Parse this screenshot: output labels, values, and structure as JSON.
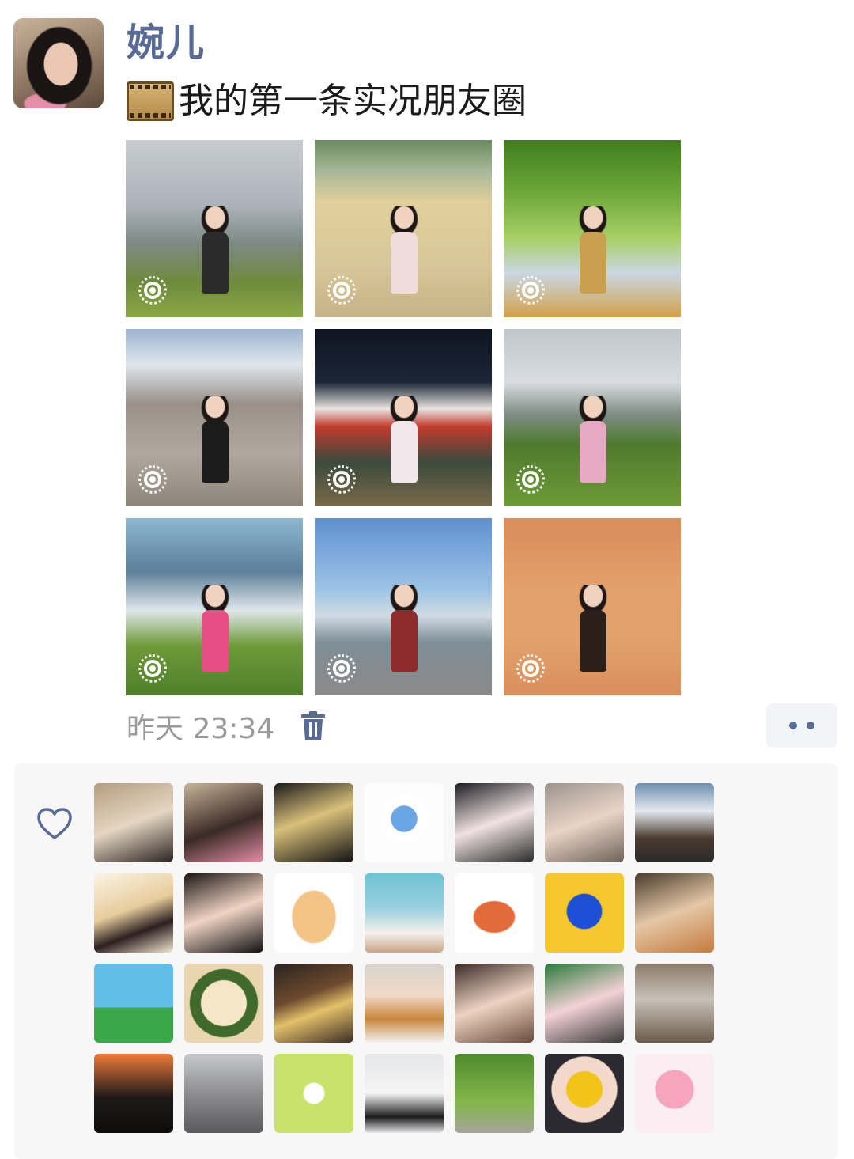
{
  "post": {
    "author": "婉儿",
    "text": "我的第一条实况朋友圈",
    "time": "昨天 23:34"
  },
  "photos": [
    {
      "name": "photo-mountain-rocks",
      "bg": "linear-gradient(180deg,#c8ccd1 0%,#aab1b8 38%,#7f8a86 58%,#6e8a3c 80%,#8aa845 100%)",
      "cloth": "#2b2b2b"
    },
    {
      "name": "photo-travertine-terraces",
      "bg": "linear-gradient(180deg,#6a8c5e 0%,#a9b89a 18%,#e1cf9c 35%,#d8c79a 70%,#c6b387 100%)",
      "cloth": "#f1dcdc"
    },
    {
      "name": "photo-tree-canopy",
      "bg": "linear-gradient(180deg,#3f7d1f 0%,#6ea83a 30%,#a7cf64 55%,#c9d7e3 75%,#d2a04a 100%)",
      "cloth": "#c8a04f"
    },
    {
      "name": "photo-snow-mountain",
      "bg": "linear-gradient(180deg,#9bb4ce 0%,#dfe6ee 20%,#9a9088 42%,#b0a89e 70%,#8e857a 100%)",
      "cloth": "#1b1b1b"
    },
    {
      "name": "photo-night-palace",
      "bg": "linear-gradient(180deg,#0f1420 0%,#1c2638 30%,#e8e3dd 45%,#c23b2e 55%,#3a4a3c 75%,#7a6a4a 100%)",
      "cloth": "#f2e8ec"
    },
    {
      "name": "photo-green-hills",
      "bg": "linear-gradient(180deg,#bfc6cc 0%,#d9dde1 30%,#7f8e84 48%,#4f7a2e 65%,#6f9a38 100%)",
      "cloth": "#e7a9c4"
    },
    {
      "name": "photo-tree-clouds",
      "bg": "linear-gradient(180deg,#8eb8cf 0%,#5c7f9a 30%,#dfe6ea 52%,#6f9a3a 72%,#4f7f2a 100%)",
      "cloth": "#e64f86"
    },
    {
      "name": "photo-lake-railing",
      "bg": "linear-gradient(180deg,#5f8fcf 0%,#9cc3e6 40%,#cfdbe2 55%,#7f8e97 70%,#8a8a8a 100%)",
      "cloth": "#8c2c2c"
    },
    {
      "name": "photo-sandstorm",
      "bg": "linear-gradient(180deg,#d98d5a 0%,#e3a06a 40%,#e2a06b 70%,#d88f5c 100%)",
      "cloth": "#2b1f1a"
    }
  ],
  "likes": [
    "linear-gradient(160deg,#b59d7f,#e4d6c2 50%,#2a2220)",
    "linear-gradient(160deg,#c9b49a,#3a2a25 55%,#e48fa7)",
    "linear-gradient(160deg,#1a1a1a,#d9c07a 45%,#111)",
    "radial-gradient(circle at 50% 45%,#6aa6e6 0 22%,#ffffff 23% 40%,#fdfdfd 41%)",
    "linear-gradient(160deg,#1d1d22,#f0e2e2 50%,#2a2a2a)",
    "linear-gradient(160deg,#9c948c,#e9d4c7 50%,#6e6258)",
    "linear-gradient(180deg,#6f8fb0,#e5e9ef 35%,#4a3a2e 70%,#2a2a2a)",
    "linear-gradient(160deg,#fbf4e4,#e7cc9d 45%,#2b2020 70%,#f2e8d2)",
    "linear-gradient(160deg,#1b1614,#f0d4c4 50%,#111)",
    "radial-gradient(ellipse 30% 36% at 50% 55%,#f4c487 0 90%,#ffffff 95%)",
    "linear-gradient(180deg,#6ec3d6,#9bd0de 45%,#f5f1eb 75%,#c9a58a)",
    "radial-gradient(ellipse 42% 32% at 50% 55%,#e36a3a 0 60%,#ffffff 65%)",
    "radial-gradient(circle at 50% 48%,#1f4fd6 0 30%,#f4c82d 32%)",
    "linear-gradient(160deg,#4a3c2c,#e4c7a7 50%,#c57a3d)",
    "linear-gradient(180deg,#5fbfe6 0 55%,#3aa84a 56%)",
    "radial-gradient(circle at 50% 50%,#f6e6c8 0 40%,#3f6a2c 42% 60%,#e9d6b0 62%)",
    "linear-gradient(160deg,#2a2420,#6d4a2e 40%,#e5c16a 60%,#3b2c22)",
    "linear-gradient(180deg,#d8d4cc,#f1d9c7 40%,#c9863c 70%,#f2f2f2)",
    "linear-gradient(160deg,#3b2a25,#edd3c3 50%,#6a4a3a)",
    "linear-gradient(160deg,#2a7a3a,#f3d2d6 50%,#3a3a3a)",
    "linear-gradient(180deg,#8b7a6a,#c9c2b8 45%,#6a5a4a)",
    "linear-gradient(180deg,#f07a3a,#1e1a18 55%,#0e0c0b)",
    "linear-gradient(180deg,#c6c8cc,#8e8e90 50%,#5a5a5c)",
    "radial-gradient(circle at 50% 50%,#ffffff 0 18%,#c8e26a 20%)",
    "linear-gradient(180deg,#e6e7e9,#f4f4f4 50%,#1a1a1a 80%,#e6e7e9)",
    "linear-gradient(180deg,#4f8a2e,#83b64a 60%,#a4a49a)",
    "radial-gradient(circle at 50% 45%,#f2c318 0 30%,#f3d9c9 32% 55%,#2b2a30 57%)",
    "radial-gradient(circle at 50% 45%,#f7a5bf 0 32%,#fbeef2 34%)"
  ],
  "icons": {
    "live": "live-photo-icon",
    "trash": "trash-icon",
    "heart": "heart-outline-icon",
    "more": "more-dots-icon",
    "film": "film-reel-icon"
  },
  "colors": {
    "name": "#576b95",
    "time": "#9a9a9a",
    "panel": "#f7f7f7"
  }
}
